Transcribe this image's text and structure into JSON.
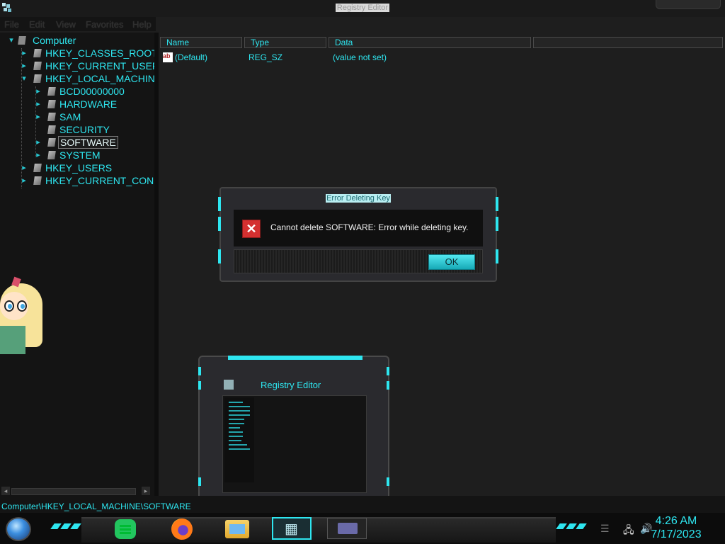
{
  "window": {
    "title": "Registry Editor"
  },
  "menu": [
    "File",
    "Edit",
    "View",
    "Favorites",
    "Help"
  ],
  "tree": {
    "items": [
      {
        "label": "Computer",
        "expander": "▾",
        "icon": "computer-icon"
      },
      {
        "label": "HKEY_CLASSES_ROOT",
        "expander": "▸",
        "icon": "folder-icon"
      },
      {
        "label": "HKEY_CURRENT_USER",
        "expander": "▸",
        "icon": "folder-icon"
      },
      {
        "label": "HKEY_LOCAL_MACHINE",
        "expander": "▾",
        "icon": "folder-icon"
      },
      {
        "label": "BCD00000000",
        "expander": "▸",
        "icon": "folder-icon"
      },
      {
        "label": "HARDWARE",
        "expander": "▸",
        "icon": "folder-icon"
      },
      {
        "label": "SAM",
        "expander": "▸",
        "icon": "folder-icon"
      },
      {
        "label": "SECURITY",
        "expander": "",
        "icon": "folder-icon"
      },
      {
        "label": "SOFTWARE",
        "expander": "▸",
        "icon": "folder-icon",
        "selected": true
      },
      {
        "label": "SYSTEM",
        "expander": "▸",
        "icon": "folder-icon"
      },
      {
        "label": "HKEY_USERS",
        "expander": "▸",
        "icon": "folder-icon"
      },
      {
        "label": "HKEY_CURRENT_CONFI",
        "expander": "▸",
        "icon": "folder-icon"
      }
    ]
  },
  "list": {
    "columns": [
      "Name",
      "Type",
      "Data"
    ],
    "rows": [
      {
        "name": "(Default)",
        "type": "REG_SZ",
        "data": "(value not set)",
        "icon_text": "ab"
      }
    ]
  },
  "status": {
    "path": "Computer\\HKEY_LOCAL_MACHINE\\SOFTWARE"
  },
  "dialog": {
    "title": "Error Deleting Key",
    "message": "Cannot delete SOFTWARE:  Error while deleting key.",
    "ok_label": "OK",
    "error_glyph": "✕"
  },
  "thumbnail": {
    "title": "Registry Editor"
  },
  "taskbar": {
    "apps": [
      "notes-icon",
      "firefox-icon",
      "file-explorer-icon",
      "registry-editor-icon",
      "card-icon"
    ],
    "clock": {
      "time": "4:26 AM",
      "date": "7/17/2023"
    },
    "tray": {
      "network": "🖧",
      "volume": "🔊"
    }
  },
  "colors": {
    "accent": "#2ee6f0",
    "background": "#1e1e1e",
    "panel": "#141414",
    "error": "#d43030"
  }
}
